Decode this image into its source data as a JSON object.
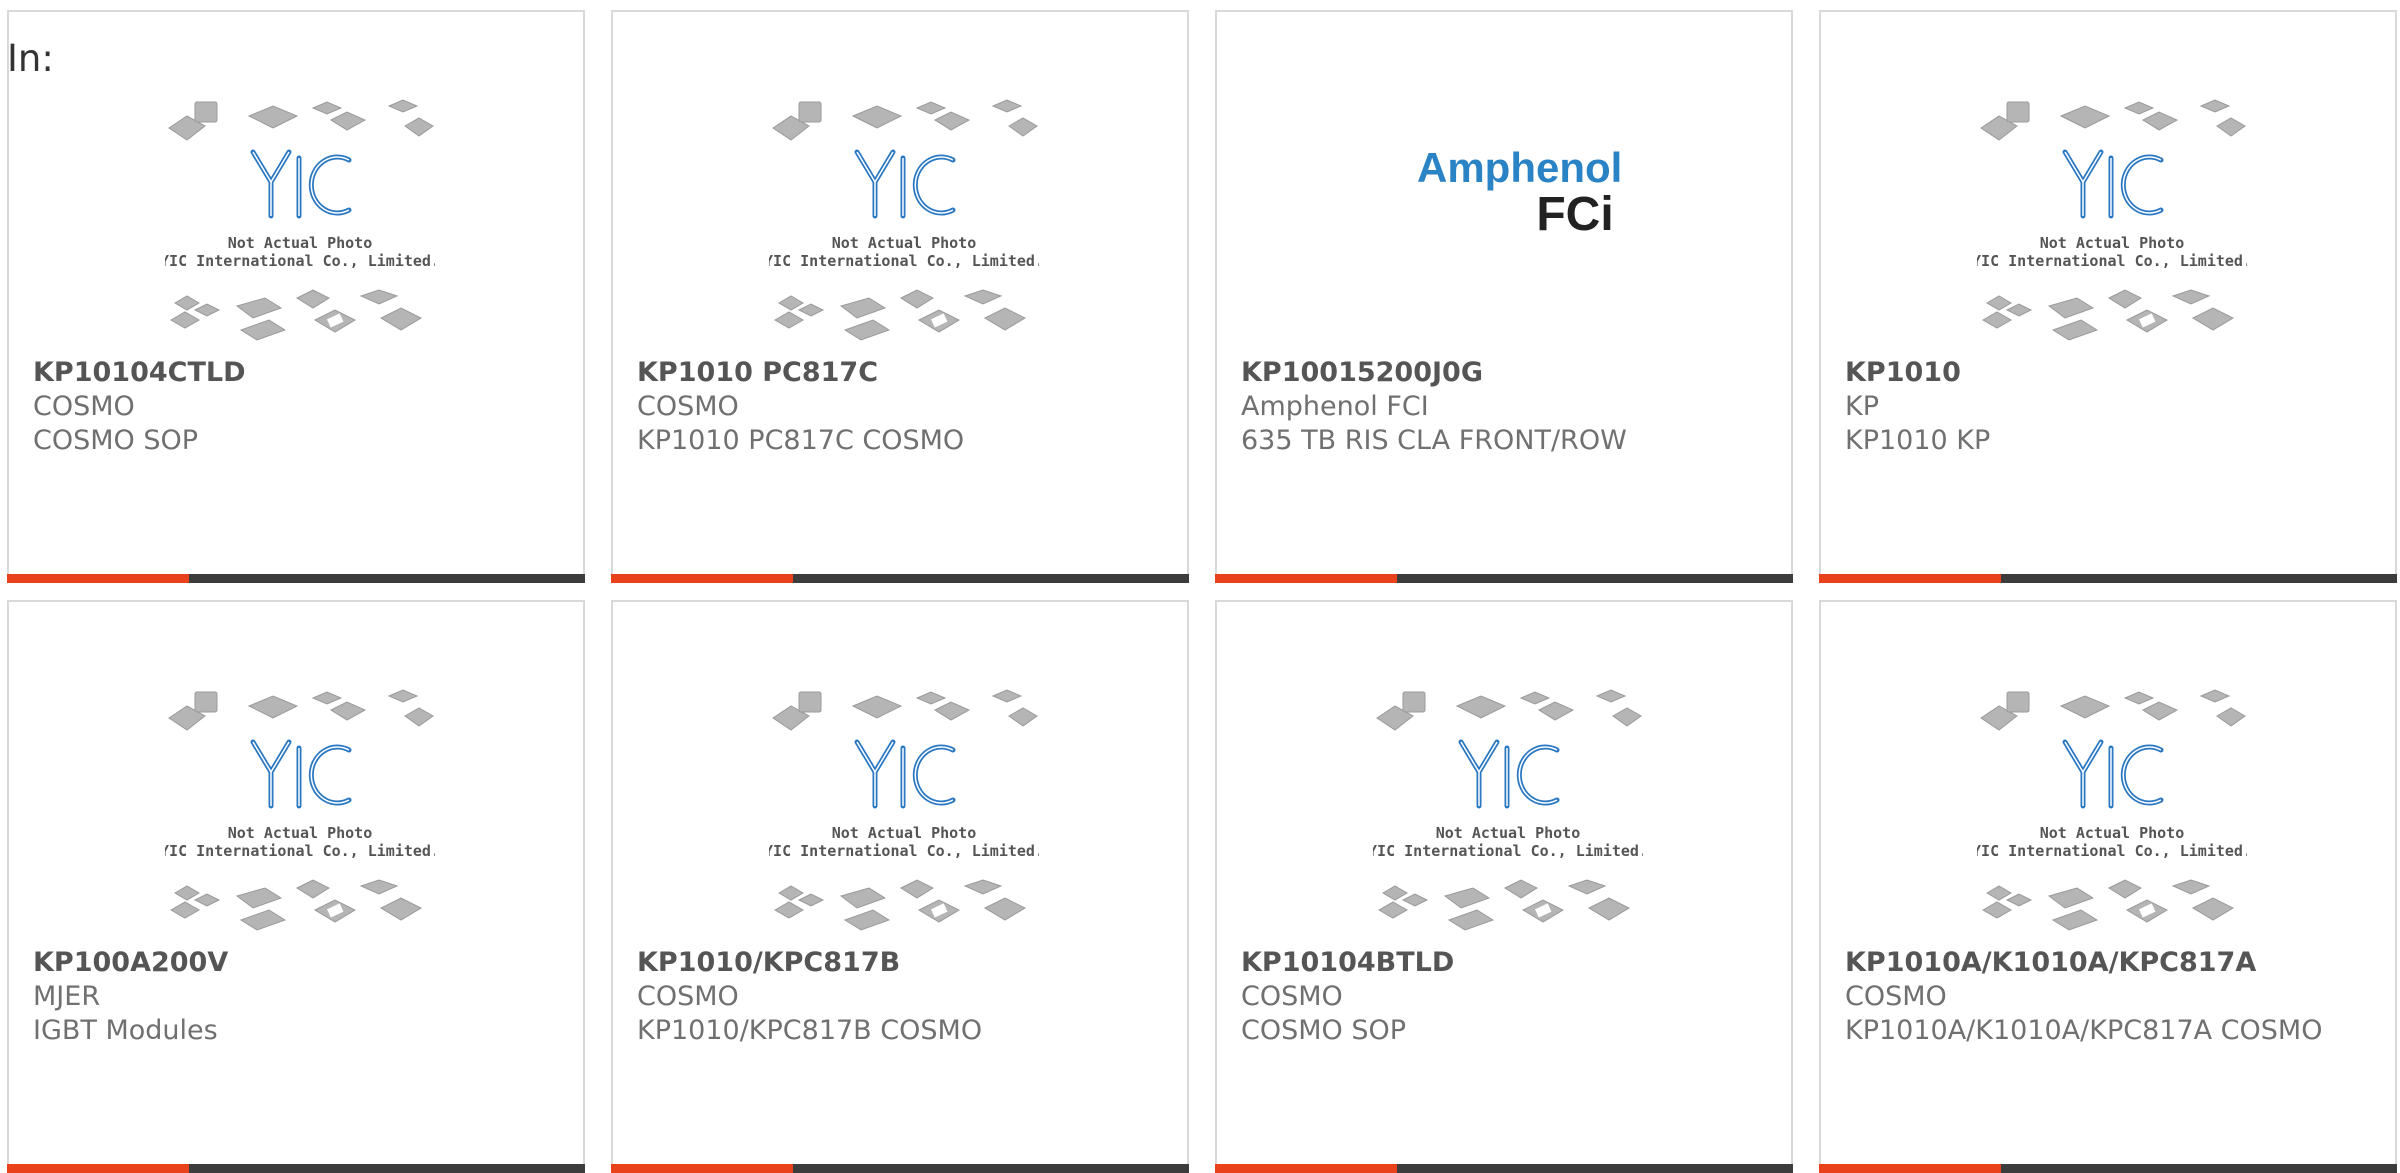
{
  "filter": {
    "label": "In:"
  },
  "placeholder_image": {
    "line1": "Not Actual Photo",
    "line2": "YIC International Co., Limited.",
    "logo": "YIC"
  },
  "products": [
    {
      "part": "KP10104CTLD",
      "brand": "COSMO",
      "description": "COSMO SOP",
      "image": "yic-placeholder"
    },
    {
      "part": "KP1010 PC817C",
      "brand": "COSMO",
      "description": "KP1010 PC817C COSMO",
      "image": "yic-placeholder"
    },
    {
      "part": "KP10015200J0G",
      "brand": "Amphenol FCI",
      "description": "635 TB RIS CLA FRONT/ROW",
      "image": "amphenol-fci-logo",
      "logo_text": {
        "line1": "Amphenol",
        "line2": "FCi"
      }
    },
    {
      "part": "KP1010",
      "brand": "KP",
      "description": "KP1010 KP",
      "image": "yic-placeholder"
    },
    {
      "part": "KP100A200V",
      "brand": "MJER",
      "description": "IGBT Modules",
      "image": "yic-placeholder"
    },
    {
      "part": "KP1010/KPC817B",
      "brand": "COSMO",
      "description": "KP1010/KPC817B COSMO",
      "image": "yic-placeholder"
    },
    {
      "part": "KP10104BTLD",
      "brand": "COSMO",
      "description": "COSMO SOP",
      "image": "yic-placeholder"
    },
    {
      "part": "KP1010A/K1010A/KPC817A",
      "brand": "COSMO",
      "description": "KP1010A/K1010A/KPC817A COSMO",
      "image": "yic-placeholder"
    }
  ],
  "colors": {
    "accent": "#e8411c",
    "bar": "#3c3c3c",
    "border": "#d9d9d9",
    "yic_blue": "#2b78c2"
  }
}
